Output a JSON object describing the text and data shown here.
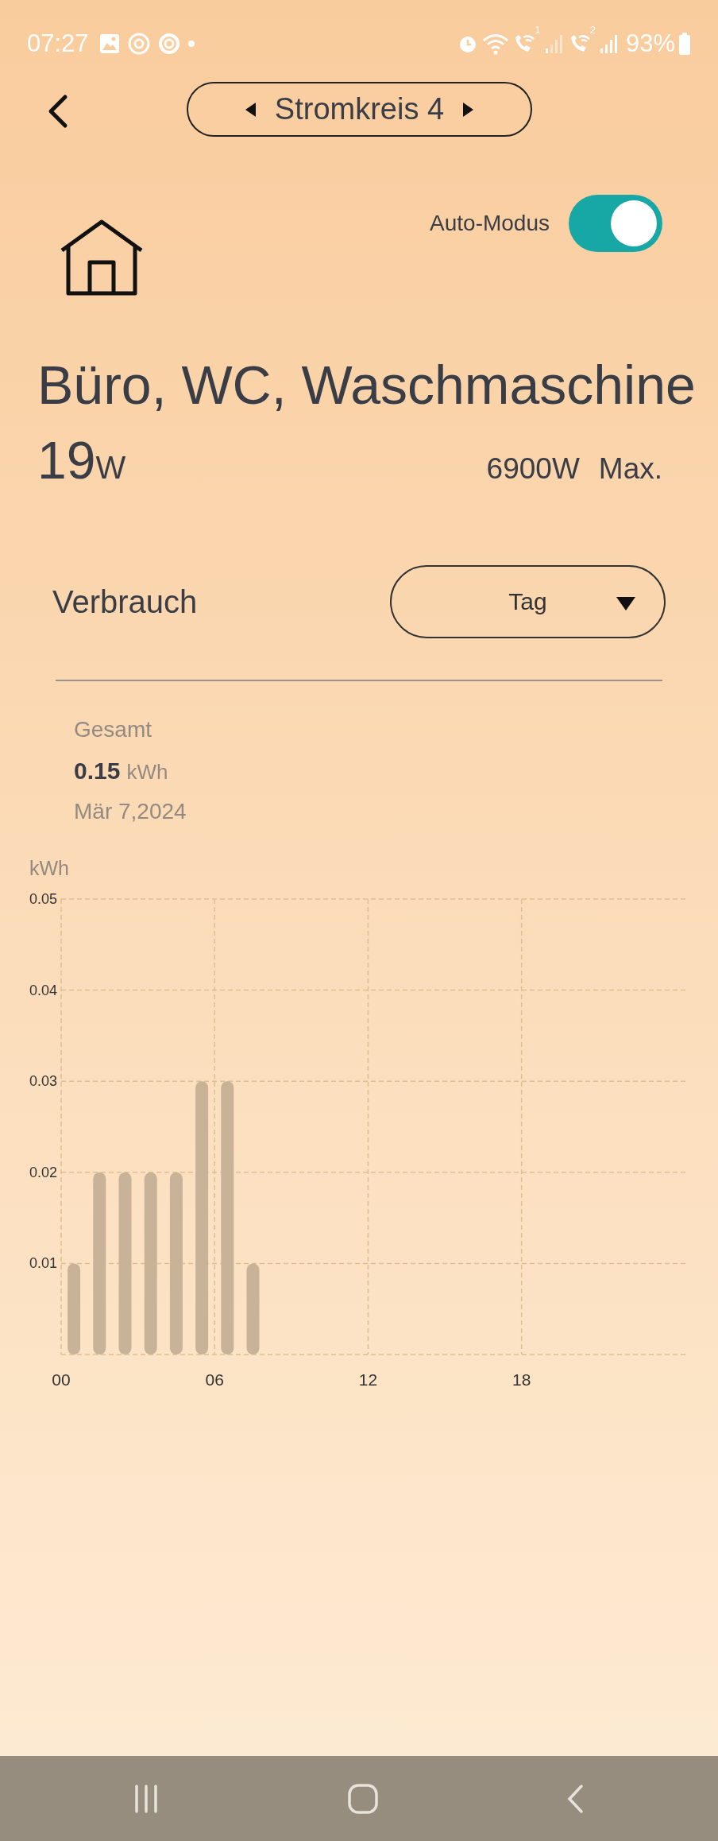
{
  "status_bar": {
    "time": "07:27",
    "sims": [
      "1",
      "2"
    ],
    "battery": "93%"
  },
  "header": {
    "circuit": "Stromkreis 4"
  },
  "auto_mode": {
    "label": "Auto-Modus",
    "on": true
  },
  "circuit_name": "Büro, WC, Waschmaschine",
  "power": {
    "value": "19",
    "unit": "W"
  },
  "max": {
    "value": "6900W",
    "label": "Max."
  },
  "consumption": {
    "label": "Verbrauch",
    "period": "Tag"
  },
  "summary": {
    "label": "Gesamt",
    "value": "0.15",
    "unit": "kWh",
    "date": "Mär 7,2024"
  },
  "chart": {
    "chart_data": {
      "type": "bar",
      "ylabel": "kWh",
      "x": [
        0.5,
        1.5,
        2.5,
        3.5,
        4.5,
        5.5,
        6.5,
        7.5
      ],
      "values": [
        0.01,
        0.02,
        0.02,
        0.02,
        0.02,
        0.03,
        0.03,
        0.01
      ],
      "xlim": [
        0,
        24.5
      ],
      "grid": true,
      "ylim": [
        0,
        0.05
      ],
      "xticks": [
        {
          "value": 0,
          "label": "00"
        },
        {
          "value": 6,
          "label": "06"
        },
        {
          "value": 12,
          "label": "12"
        },
        {
          "value": 18,
          "label": "18"
        }
      ],
      "yticks": [
        0.01,
        0.02,
        0.03,
        0.04,
        0.05
      ]
    }
  }
}
